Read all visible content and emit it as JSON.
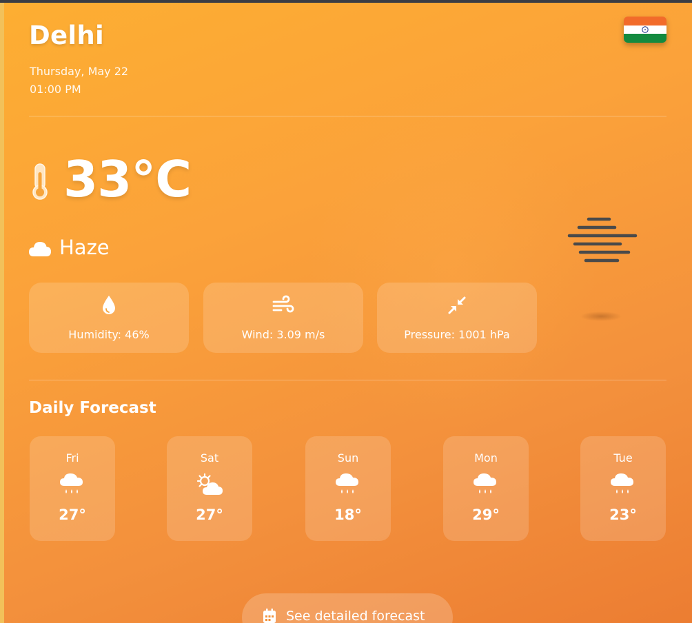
{
  "location": {
    "city": "Delhi",
    "date": "Thursday, May 22",
    "time": "01:00 PM",
    "country_flag": "india-flag"
  },
  "current": {
    "temperature": "33°C",
    "condition": "Haze",
    "condition_icon": "cloud-icon",
    "large_icon": "haze-icon"
  },
  "stats": [
    {
      "icon": "droplet-icon",
      "label": "Humidity: 46%"
    },
    {
      "icon": "wind-icon",
      "label": "Wind: 3.09 m/s"
    },
    {
      "icon": "compress-icon",
      "label": "Pressure: 1001 hPa"
    }
  ],
  "forecast": {
    "title": "Daily Forecast",
    "days": [
      {
        "day": "Fri",
        "icon": "cloud-rain-icon",
        "temp": "27°"
      },
      {
        "day": "Sat",
        "icon": "cloud-sun-icon",
        "temp": "27°"
      },
      {
        "day": "Sun",
        "icon": "cloud-rain-icon",
        "temp": "18°"
      },
      {
        "day": "Mon",
        "icon": "cloud-rain-icon",
        "temp": "29°"
      },
      {
        "day": "Tue",
        "icon": "cloud-rain-icon",
        "temp": "23°"
      }
    ]
  },
  "cta": {
    "label": "See detailed forecast",
    "icon": "calendar-icon"
  },
  "colors": {
    "gradient_start": "#fdae32",
    "gradient_end": "#ec7d32",
    "text": "#ffffff",
    "haze_icon": "#4a4a4a"
  }
}
